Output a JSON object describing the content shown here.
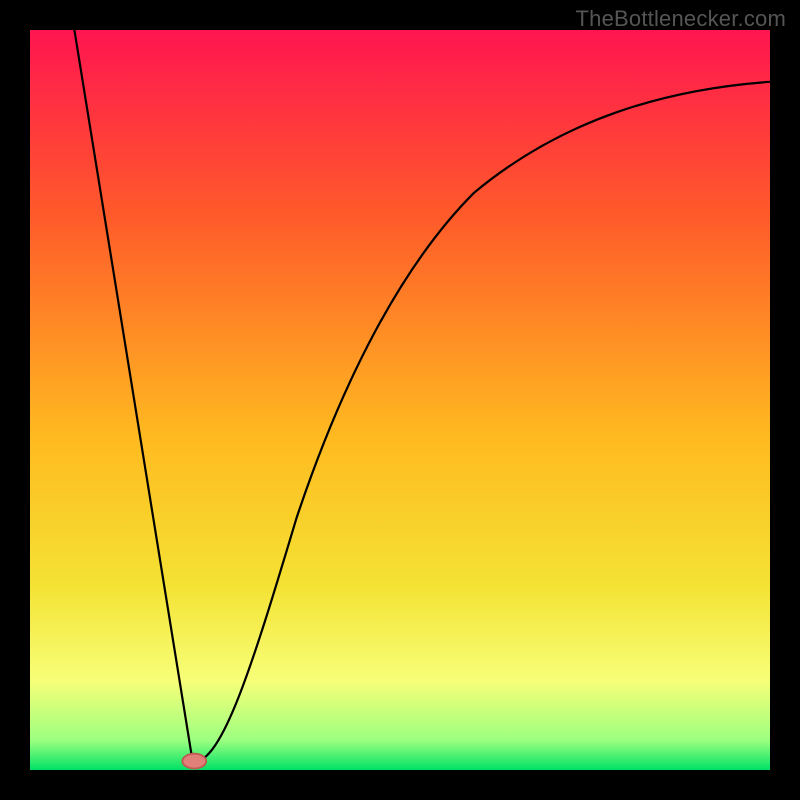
{
  "watermark": "TheBottlenecker.com",
  "chart_data": {
    "type": "line",
    "title": "",
    "xlabel": "",
    "ylabel": "",
    "xlim": [
      0,
      100
    ],
    "ylim": [
      0,
      100
    ],
    "background_gradient_stops": [
      {
        "offset": 0,
        "color": "#ff1550"
      },
      {
        "offset": 25,
        "color": "#ff5a2a"
      },
      {
        "offset": 55,
        "color": "#ffba20"
      },
      {
        "offset": 75,
        "color": "#f4e233"
      },
      {
        "offset": 88,
        "color": "#f7ff78"
      },
      {
        "offset": 96,
        "color": "#9cff80"
      },
      {
        "offset": 100,
        "color": "#00e266"
      }
    ],
    "series": [
      {
        "name": "bottleneck-curve",
        "stroke": "#000000",
        "stroke_width": 2.2,
        "points": [
          {
            "x": 6,
            "y": 100
          },
          {
            "x": 22,
            "y": 1
          }
        ],
        "right_branch": {
          "start": {
            "x": 22,
            "y": 1
          },
          "curve": [
            {
              "cx1": 26,
              "cy1": 1,
              "cx2": 30,
              "cy2": 14,
              "x": 36,
              "y": 34
            },
            {
              "cx1": 42,
              "cy1": 52,
              "cx2": 50,
              "cy2": 68,
              "x": 60,
              "y": 78
            },
            {
              "cx1": 72,
              "cy1": 88,
              "cx2": 86,
              "cy2": 92,
              "x": 100,
              "y": 93
            }
          ]
        }
      }
    ],
    "marker": {
      "name": "optimal-point",
      "cx": 22.2,
      "cy": 1.2,
      "rx": 1.6,
      "ry": 1.0,
      "fill": "#e08078",
      "stroke": "#c05a52"
    }
  }
}
